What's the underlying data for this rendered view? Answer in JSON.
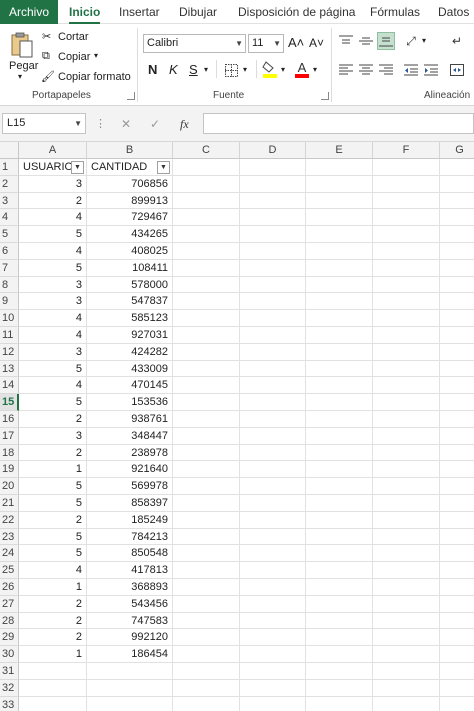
{
  "tabs": [
    {
      "label": "Archivo"
    },
    {
      "label": "Inicio"
    },
    {
      "label": "Insertar"
    },
    {
      "label": "Dibujar"
    },
    {
      "label": "Disposición de página"
    },
    {
      "label": "Fórmulas"
    },
    {
      "label": "Datos"
    }
  ],
  "ribbon": {
    "clipboard": {
      "paste": "Pegar",
      "cut": "Cortar",
      "copy": "Copiar",
      "format_painter": "Copiar formato",
      "group_label": "Portapapeles"
    },
    "font": {
      "font_name": "Calibri",
      "font_size": "11",
      "grow": "A˄",
      "shrink": "A˅",
      "bold": "N",
      "italic": "K",
      "underline": "S",
      "group_label": "Fuente",
      "fill_color": "#ffff00",
      "font_color": "#ff0000"
    },
    "alignment": {
      "group_label": "Alineación"
    }
  },
  "formula_bar": {
    "name_box": "L15",
    "cancel": "✕",
    "enter": "✓",
    "fx": "fx",
    "value": ""
  },
  "grid": {
    "columns": [
      "A",
      "B",
      "C",
      "D",
      "E",
      "F",
      "G"
    ],
    "headers": [
      "USUARIO",
      "CANTIDAD"
    ],
    "selected_row": "15",
    "rows": [
      {
        "n": "1"
      },
      {
        "n": "2",
        "a": "3",
        "b": "706856"
      },
      {
        "n": "3",
        "a": "2",
        "b": "899913"
      },
      {
        "n": "4",
        "a": "4",
        "b": "729467"
      },
      {
        "n": "5",
        "a": "5",
        "b": "434265"
      },
      {
        "n": "6",
        "a": "4",
        "b": "408025"
      },
      {
        "n": "7",
        "a": "5",
        "b": "108411"
      },
      {
        "n": "8",
        "a": "3",
        "b": "578000"
      },
      {
        "n": "9",
        "a": "3",
        "b": "547837"
      },
      {
        "n": "10",
        "a": "4",
        "b": "585123"
      },
      {
        "n": "11",
        "a": "4",
        "b": "927031"
      },
      {
        "n": "12",
        "a": "3",
        "b": "424282"
      },
      {
        "n": "13",
        "a": "5",
        "b": "433009"
      },
      {
        "n": "14",
        "a": "4",
        "b": "470145"
      },
      {
        "n": "15",
        "a": "5",
        "b": "153536"
      },
      {
        "n": "16",
        "a": "2",
        "b": "938761"
      },
      {
        "n": "17",
        "a": "3",
        "b": "348447"
      },
      {
        "n": "18",
        "a": "2",
        "b": "238978"
      },
      {
        "n": "19",
        "a": "1",
        "b": "921640"
      },
      {
        "n": "20",
        "a": "5",
        "b": "569978"
      },
      {
        "n": "21",
        "a": "5",
        "b": "858397"
      },
      {
        "n": "22",
        "a": "2",
        "b": "185249"
      },
      {
        "n": "23",
        "a": "5",
        "b": "784213"
      },
      {
        "n": "24",
        "a": "5",
        "b": "850548"
      },
      {
        "n": "25",
        "a": "4",
        "b": "417813"
      },
      {
        "n": "26",
        "a": "1",
        "b": "368893"
      },
      {
        "n": "27",
        "a": "2",
        "b": "543456"
      },
      {
        "n": "28",
        "a": "2",
        "b": "747583"
      },
      {
        "n": "29",
        "a": "2",
        "b": "992120"
      },
      {
        "n": "30",
        "a": "1",
        "b": "186454"
      },
      {
        "n": "31"
      },
      {
        "n": "32"
      },
      {
        "n": "33"
      }
    ]
  },
  "colors": {
    "accent": "#217346"
  }
}
